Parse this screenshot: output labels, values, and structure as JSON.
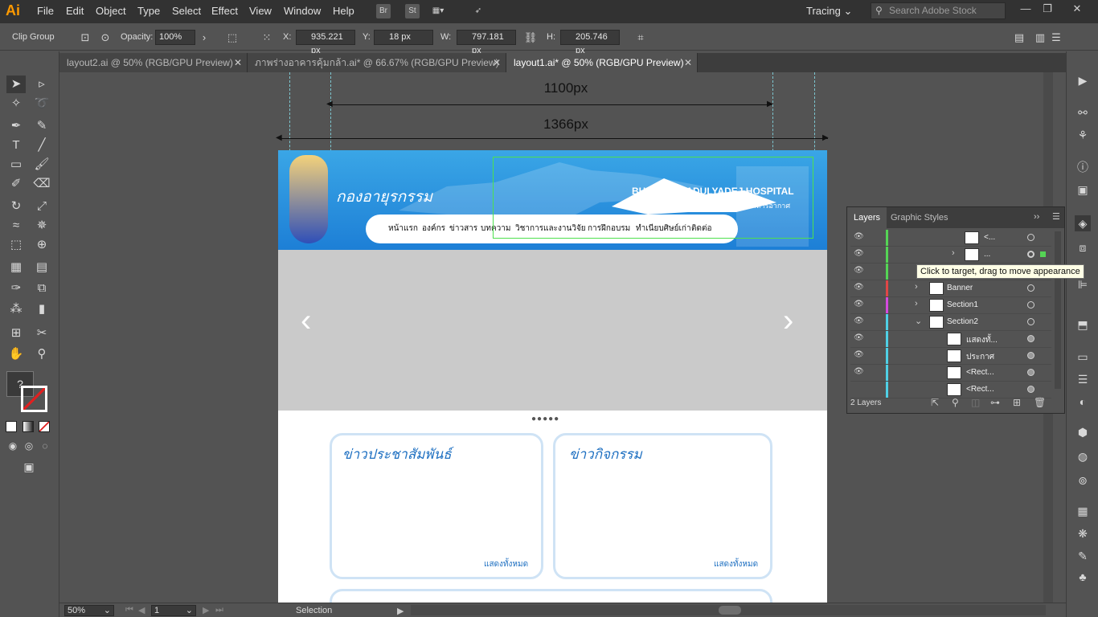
{
  "app": {
    "logo": "Ai"
  },
  "menu": [
    "File",
    "Edit",
    "Object",
    "Type",
    "Select",
    "Effect",
    "View",
    "Window",
    "Help"
  ],
  "menubar_icons": {
    "bridge": "Br",
    "stock": "St"
  },
  "workspace": "Tracing",
  "search": {
    "placeholder": "Search Adobe Stock"
  },
  "control": {
    "selection_type": "Clip Group",
    "opacity_label": "Opacity:",
    "opacity": "100%",
    "x_label": "X:",
    "x": "935.221 px",
    "y_label": "Y:",
    "y": "18 px",
    "w_label": "W:",
    "w": "797.181 px",
    "h_label": "H:",
    "h": "205.746 px"
  },
  "tabs": [
    {
      "label": "layout2.ai @ 50% (RGB/GPU Preview)"
    },
    {
      "label": "ภาพร่างอาคารคุ้มกล้า.ai* @ 66.67% (RGB/GPU Preview)"
    },
    {
      "label": "layout1.ai* @ 50% (RGB/GPU Preview)"
    }
  ],
  "artwork": {
    "dim_1100": "1100px",
    "dim_1366": "1366px",
    "site_title": "กองอายุรกรรม",
    "hospital_en": "BHUMIBOL ADULYADEJ HOSPITAL",
    "hospital_th": "โรงพยาบาลภูมิพลอดุลยเดช กรมแพทย์ทหารอากาศ",
    "nav": [
      "หน้าแรก",
      "องค์กร",
      "ข่าวสาร",
      "บทความ",
      "วิชาการและงานวิจัย",
      "การฝึกอบรม",
      "ทำเนียบศิษย์เก่า",
      "ติดต่อ"
    ],
    "card1_title": "ข่าวประชาสัมพันธ์",
    "card2_title": "ข่าวกิจกรรม",
    "show_all": "แสดงทั้งหมด",
    "dots": "●●●●●"
  },
  "layers_panel": {
    "tabs": [
      "Layers",
      "Graphic Styles"
    ],
    "rows": [
      {
        "name": "<...",
        "color": "#55d455"
      },
      {
        "name": "...",
        "color": "#55d455"
      },
      {
        "name": "",
        "color": "#55d455"
      },
      {
        "name": "Banner",
        "color": "#e04646"
      },
      {
        "name": "Section1",
        "color": "#d44adf"
      },
      {
        "name": "Section2",
        "color": "#4fd0e6"
      },
      {
        "name": "แสดงทั้...",
        "color": "#4fd0e6"
      },
      {
        "name": "ประกาศ",
        "color": "#4fd0e6"
      },
      {
        "name": "<Rect...",
        "color": "#4fd0e6"
      },
      {
        "name": "<Rect...",
        "color": "#4fd0e6"
      }
    ],
    "footer": "2 Layers"
  },
  "tooltip": "Click to target, drag to move appearance",
  "status": {
    "zoom": "50%",
    "page": "1",
    "tool": "Selection"
  },
  "colors": {
    "accent": "#ff9a00",
    "banner": "#1d7fd6"
  }
}
